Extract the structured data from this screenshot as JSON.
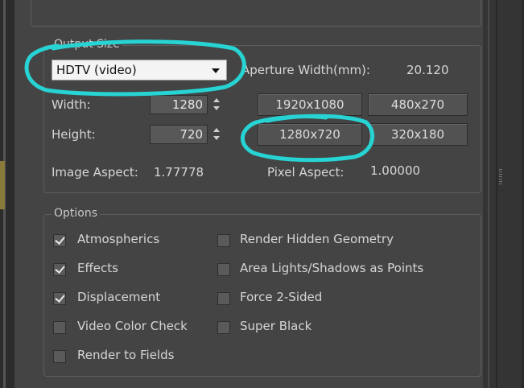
{
  "output_size": {
    "group_title": "Output Size",
    "preset": {
      "value": "HDTV (video)"
    },
    "aperture": {
      "label": "Aperture Width(mm):",
      "value": "20.120"
    },
    "width": {
      "label": "Width:",
      "value": "1280"
    },
    "height": {
      "label": "Height:",
      "value": "720"
    },
    "presets": [
      "1920x1080",
      "480x270",
      "1280x720",
      "320x180"
    ],
    "image_aspect": {
      "label": "Image Aspect:",
      "value": "1.77778"
    },
    "pixel_aspect": {
      "label": "Pixel Aspect:",
      "value": "1.00000"
    }
  },
  "options": {
    "group_title": "Options",
    "left": [
      {
        "label": "Atmospherics",
        "checked": true
      },
      {
        "label": "Effects",
        "checked": true
      },
      {
        "label": "Displacement",
        "checked": true
      },
      {
        "label": "Video Color Check",
        "checked": false
      },
      {
        "label": "Render to Fields",
        "checked": false
      }
    ],
    "right": [
      {
        "label": "Render Hidden Geometry",
        "checked": false
      },
      {
        "label": "Area Lights/Shadows as Points",
        "checked": false
      },
      {
        "label": "Force 2-Sided",
        "checked": false
      },
      {
        "label": "Super Black",
        "checked": false
      }
    ]
  },
  "colors": {
    "panel": "#444444",
    "annotation": "#27d3d3"
  }
}
